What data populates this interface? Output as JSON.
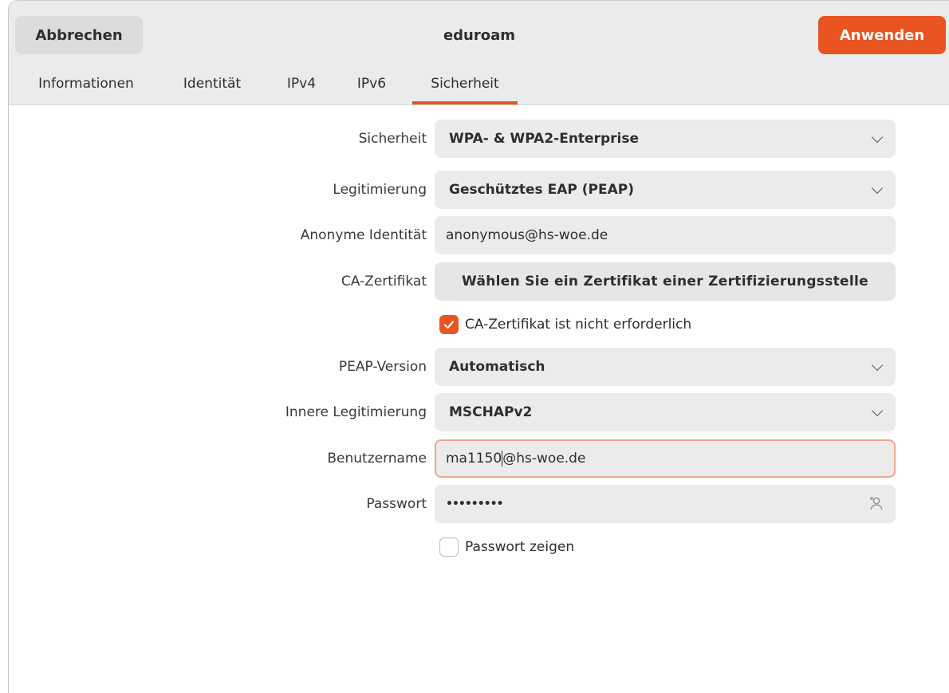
{
  "header": {
    "cancel_label": "Abbrechen",
    "title": "eduroam",
    "apply_label": "Anwenden",
    "accent": "#e95420"
  },
  "tabs": [
    {
      "label": "Informationen"
    },
    {
      "label": "Identität"
    },
    {
      "label": "IPv4"
    },
    {
      "label": "IPv6"
    },
    {
      "label": "Sicherheit",
      "active": true
    }
  ],
  "form": {
    "security": {
      "label": "Sicherheit",
      "value": "WPA- & WPA2-Enterprise"
    },
    "authentication": {
      "label": "Legitimierung",
      "value": "Geschütztes EAP (PEAP)"
    },
    "anonymous_identity": {
      "label": "Anonyme Identität",
      "value": "anonymous@hs-woe.de"
    },
    "ca_certificate": {
      "label": "CA-Zertifikat",
      "button": "Wählen Sie ein Zertifikat einer Zertifizierungsstelle"
    },
    "ca_not_required": {
      "label": "CA-Zertifikat ist nicht erforderlich",
      "checked": true
    },
    "peap_version": {
      "label": "PEAP-Version",
      "value": "Automatisch"
    },
    "inner_auth": {
      "label": "Innere Legitimierung",
      "value": "MSCHAPv2"
    },
    "username": {
      "label": "Benutzername",
      "value_before_cursor": "ma1150",
      "value_after_cursor": "@hs-woe.de"
    },
    "password": {
      "label": "Passwort",
      "value": "•••••••••",
      "icon": "user-options-icon"
    },
    "show_password": {
      "label": "Passwort zeigen",
      "checked": false
    }
  }
}
